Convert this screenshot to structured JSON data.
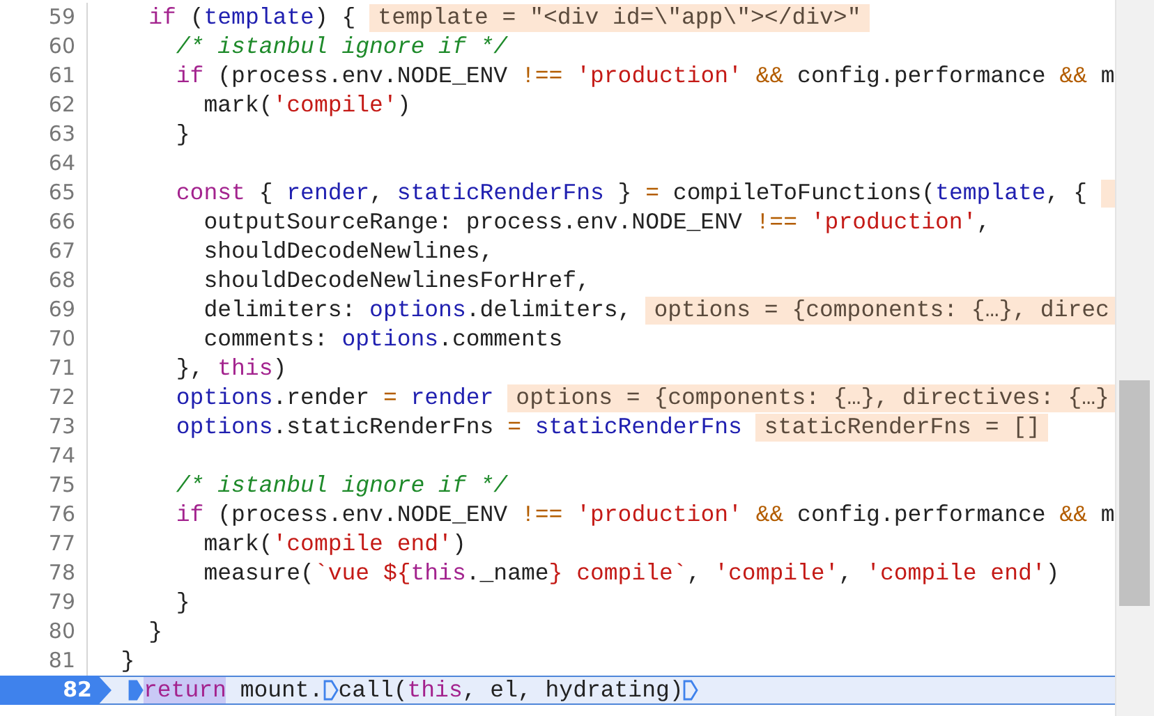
{
  "editor": {
    "lines": [
      {
        "number": "59",
        "current": false,
        "segments": [
          {
            "kind": "code",
            "tokens": [
              {
                "kind": "kw",
                "text": "    if"
              },
              {
                "kind": "plain",
                "text": " ("
              },
              {
                "kind": "var",
                "text": "template"
              },
              {
                "kind": "plain",
                "text": ") {"
              }
            ]
          },
          {
            "kind": "value",
            "text": "template = \"<div id=\\\"app\\\"></div>\""
          }
        ]
      },
      {
        "number": "60",
        "current": false,
        "segments": [
          {
            "kind": "code",
            "tokens": [
              {
                "kind": "com",
                "text": "      /* istanbul ignore if */"
              }
            ]
          }
        ]
      },
      {
        "number": "61",
        "current": false,
        "segments": [
          {
            "kind": "code",
            "tokens": [
              {
                "kind": "kw",
                "text": "      if"
              },
              {
                "kind": "plain",
                "text": " (process.env.NODE_ENV "
              },
              {
                "kind": "op",
                "text": "!=="
              },
              {
                "kind": "str",
                "text": " 'production'"
              },
              {
                "kind": "op",
                "text": " &&"
              },
              {
                "kind": "plain",
                "text": " config.performance "
              },
              {
                "kind": "op",
                "text": "&&"
              },
              {
                "kind": "plain",
                "text": " m"
              }
            ]
          }
        ]
      },
      {
        "number": "62",
        "current": false,
        "segments": [
          {
            "kind": "code",
            "tokens": [
              {
                "kind": "plain",
                "text": "        mark("
              },
              {
                "kind": "str",
                "text": "'compile'"
              },
              {
                "kind": "plain",
                "text": ")"
              }
            ]
          }
        ]
      },
      {
        "number": "63",
        "current": false,
        "segments": [
          {
            "kind": "code",
            "tokens": [
              {
                "kind": "plain",
                "text": "      }"
              }
            ]
          }
        ]
      },
      {
        "number": "64",
        "current": false
      },
      {
        "number": "65",
        "current": false,
        "segments": [
          {
            "kind": "code",
            "tokens": [
              {
                "kind": "kw",
                "text": "      const"
              },
              {
                "kind": "plain",
                "text": " { "
              },
              {
                "kind": "var",
                "text": "render"
              },
              {
                "kind": "plain",
                "text": ", "
              },
              {
                "kind": "var",
                "text": "staticRenderFns"
              },
              {
                "kind": "plain",
                "text": " } "
              },
              {
                "kind": "op",
                "text": "="
              },
              {
                "kind": "plain",
                "text": " compileToFunctions("
              },
              {
                "kind": "var",
                "text": "template"
              },
              {
                "kind": "plain",
                "text": ", {"
              }
            ]
          },
          {
            "kind": "value-clip"
          }
        ]
      },
      {
        "number": "66",
        "current": false,
        "segments": [
          {
            "kind": "code",
            "tokens": [
              {
                "kind": "plain",
                "text": "        outputSourceRange: process.env.NODE_ENV "
              },
              {
                "kind": "op",
                "text": "!=="
              },
              {
                "kind": "str",
                "text": " 'production'"
              },
              {
                "kind": "plain",
                "text": ","
              }
            ]
          }
        ]
      },
      {
        "number": "67",
        "current": false,
        "segments": [
          {
            "kind": "code",
            "tokens": [
              {
                "kind": "plain",
                "text": "        shouldDecodeNewlines,"
              }
            ]
          }
        ]
      },
      {
        "number": "68",
        "current": false,
        "segments": [
          {
            "kind": "code",
            "tokens": [
              {
                "kind": "plain",
                "text": "        shouldDecodeNewlinesForHref,"
              }
            ]
          }
        ]
      },
      {
        "number": "69",
        "current": false,
        "segments": [
          {
            "kind": "code",
            "tokens": [
              {
                "kind": "plain",
                "text": "        delimiters: "
              },
              {
                "kind": "var",
                "text": "options"
              },
              {
                "kind": "plain",
                "text": ".delimiters,"
              }
            ]
          },
          {
            "kind": "value",
            "text": "options = {components: {…}, direc"
          }
        ]
      },
      {
        "number": "70",
        "current": false,
        "segments": [
          {
            "kind": "code",
            "tokens": [
              {
                "kind": "plain",
                "text": "        comments: "
              },
              {
                "kind": "var",
                "text": "options"
              },
              {
                "kind": "plain",
                "text": ".comments"
              }
            ]
          }
        ]
      },
      {
        "number": "71",
        "current": false,
        "segments": [
          {
            "kind": "code",
            "tokens": [
              {
                "kind": "plain",
                "text": "      }, "
              },
              {
                "kind": "kw",
                "text": "this"
              },
              {
                "kind": "plain",
                "text": ")"
              }
            ]
          }
        ]
      },
      {
        "number": "72",
        "current": false,
        "segments": [
          {
            "kind": "code",
            "tokens": [
              {
                "kind": "var",
                "text": "      options"
              },
              {
                "kind": "plain",
                "text": ".render "
              },
              {
                "kind": "op",
                "text": "="
              },
              {
                "kind": "var",
                "text": " render"
              }
            ]
          },
          {
            "kind": "value",
            "text": "options = {components: {…}, directives: {…}"
          }
        ]
      },
      {
        "number": "73",
        "current": false,
        "segments": [
          {
            "kind": "code",
            "tokens": [
              {
                "kind": "var",
                "text": "      options"
              },
              {
                "kind": "plain",
                "text": ".staticRenderFns "
              },
              {
                "kind": "op",
                "text": "="
              },
              {
                "kind": "var",
                "text": " staticRenderFns"
              }
            ]
          },
          {
            "kind": "value",
            "text": "staticRenderFns = []"
          }
        ]
      },
      {
        "number": "74",
        "current": false
      },
      {
        "number": "75",
        "current": false,
        "segments": [
          {
            "kind": "code",
            "tokens": [
              {
                "kind": "com",
                "text": "      /* istanbul ignore if */"
              }
            ]
          }
        ]
      },
      {
        "number": "76",
        "current": false,
        "segments": [
          {
            "kind": "code",
            "tokens": [
              {
                "kind": "kw",
                "text": "      if"
              },
              {
                "kind": "plain",
                "text": " (process.env.NODE_ENV "
              },
              {
                "kind": "op",
                "text": "!=="
              },
              {
                "kind": "str",
                "text": " 'production'"
              },
              {
                "kind": "op",
                "text": " &&"
              },
              {
                "kind": "plain",
                "text": " config.performance "
              },
              {
                "kind": "op",
                "text": "&&"
              },
              {
                "kind": "plain",
                "text": " m"
              }
            ]
          }
        ]
      },
      {
        "number": "77",
        "current": false,
        "segments": [
          {
            "kind": "code",
            "tokens": [
              {
                "kind": "plain",
                "text": "        mark("
              },
              {
                "kind": "str",
                "text": "'compile end'"
              },
              {
                "kind": "plain",
                "text": ")"
              }
            ]
          }
        ]
      },
      {
        "number": "78",
        "current": false,
        "segments": [
          {
            "kind": "code",
            "tokens": [
              {
                "kind": "plain",
                "text": "        measure("
              },
              {
                "kind": "str",
                "text": "`vue ${"
              },
              {
                "kind": "kw",
                "text": "this"
              },
              {
                "kind": "plain",
                "text": "._name"
              },
              {
                "kind": "str",
                "text": "} compile`"
              },
              {
                "kind": "plain",
                "text": ", "
              },
              {
                "kind": "str",
                "text": "'compile'"
              },
              {
                "kind": "plain",
                "text": ", "
              },
              {
                "kind": "str",
                "text": "'compile end'"
              },
              {
                "kind": "plain",
                "text": ")"
              }
            ]
          }
        ]
      },
      {
        "number": "79",
        "current": false,
        "segments": [
          {
            "kind": "code",
            "tokens": [
              {
                "kind": "plain",
                "text": "      }"
              }
            ]
          }
        ]
      },
      {
        "number": "80",
        "current": false,
        "segments": [
          {
            "kind": "code",
            "tokens": [
              {
                "kind": "plain",
                "text": "    }"
              }
            ]
          }
        ]
      },
      {
        "number": "81",
        "current": false,
        "segments": [
          {
            "kind": "code",
            "tokens": [
              {
                "kind": "plain",
                "text": "  }"
              }
            ]
          }
        ]
      },
      {
        "number": "82",
        "current": true,
        "segments": [
          {
            "kind": "marker",
            "filled": true
          },
          {
            "kind": "code",
            "tokens": [
              {
                "kind": "kw-hl",
                "text": "return"
              },
              {
                "kind": "plain",
                "text": " mount."
              }
            ]
          },
          {
            "kind": "marker",
            "filled": false
          },
          {
            "kind": "code",
            "tokens": [
              {
                "kind": "plain",
                "text": "call("
              },
              {
                "kind": "kw",
                "text": "this"
              },
              {
                "kind": "plain",
                "text": ", el, hydrating)"
              }
            ]
          },
          {
            "kind": "marker",
            "filled": false
          }
        ]
      }
    ]
  }
}
